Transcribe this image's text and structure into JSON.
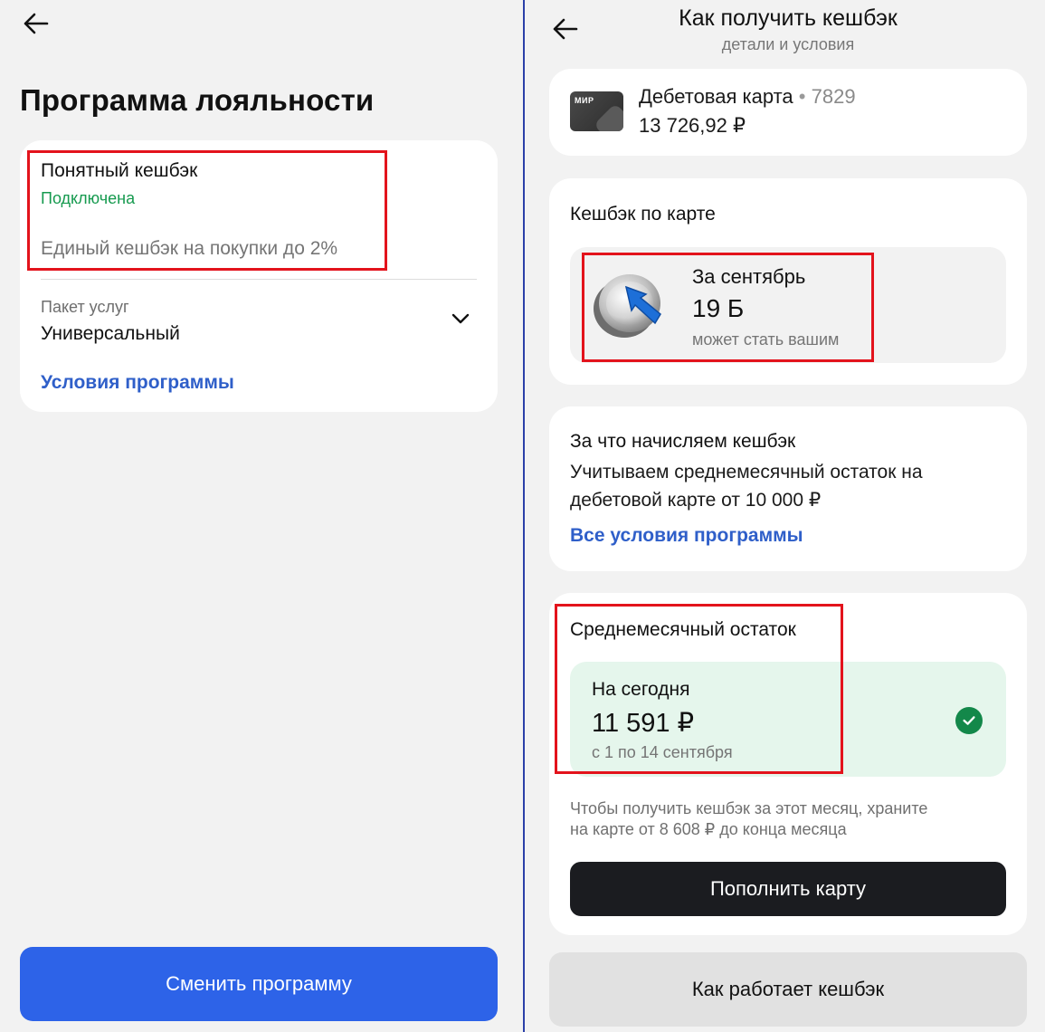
{
  "left": {
    "page_title": "Программа лояльности",
    "program": {
      "name": "Понятный кешбэк",
      "status": "Подключена",
      "description": "Единый кешбэк на покупки до 2%"
    },
    "package": {
      "label": "Пакет услуг",
      "value": "Универсальный"
    },
    "conditions_link": "Условия программы",
    "change_button": "Сменить программу"
  },
  "right": {
    "header": {
      "title": "Как получить кешбэк",
      "subtitle": "детали и условия"
    },
    "account": {
      "card_brand": "МИР",
      "name": "Дебетовая карта",
      "separator": "•",
      "number": "7829",
      "balance": "13 726,92 ₽"
    },
    "cashback": {
      "section_title": "Кешбэк по карте",
      "period": "За сентябрь",
      "amount": "19 Б",
      "note": "может стать вашим"
    },
    "accrual": {
      "title": "За что начисляем кешбэк",
      "line1": "Учитываем среднемесячный остаток на",
      "line2": "дебетовой карте от 10 000 ₽",
      "link": "Все условия программы"
    },
    "balance": {
      "title": "Среднемесячный остаток",
      "today_label": "На сегодня",
      "amount": "11 591 ₽",
      "period": "с 1 по 14 сентября",
      "hint_line1": "Чтобы получить кешбэк за этот месяц, храните",
      "hint_line2": "на карте от 8 608 ₽ до конца месяца",
      "topup_button": "Пополнить карту"
    },
    "how_it_works_button": "Как работает кешбэк"
  },
  "colors": {
    "accent_blue": "#2d63e8",
    "link_blue": "#2f5fc9",
    "status_green": "#169a4f",
    "highlight_red": "#e3131c",
    "dark_button": "#1b1c20"
  }
}
